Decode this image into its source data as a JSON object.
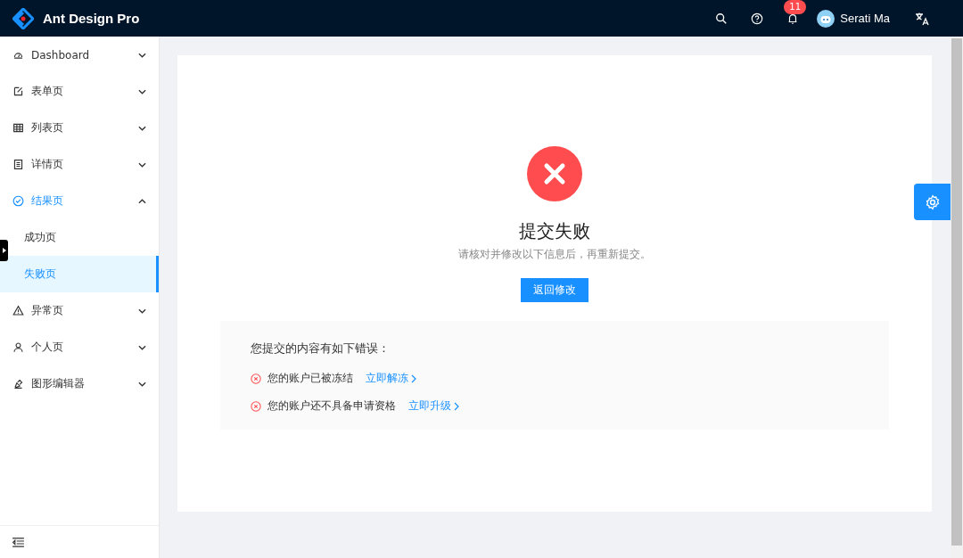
{
  "header": {
    "title": "Ant Design Pro",
    "notifications": "11",
    "user": "Serati Ma"
  },
  "menu": [
    {
      "kind": "dashboard",
      "label": "Dashboard",
      "expanded": false
    },
    {
      "kind": "form",
      "label": "表单页",
      "expanded": false
    },
    {
      "kind": "table",
      "label": "列表页",
      "expanded": false
    },
    {
      "kind": "profile",
      "label": "详情页",
      "expanded": false
    },
    {
      "kind": "result",
      "label": "结果页",
      "expanded": true,
      "children": [
        {
          "label": "成功页",
          "selected": false
        },
        {
          "label": "失败页",
          "selected": true
        }
      ]
    },
    {
      "kind": "exception",
      "label": "异常页",
      "expanded": false
    },
    {
      "kind": "account",
      "label": "个人页",
      "expanded": false
    },
    {
      "kind": "editor",
      "label": "图形编辑器",
      "expanded": false
    }
  ],
  "result": {
    "kind": "error",
    "title": "提交失败",
    "subtitle": "请核对并修改以下信息后，再重新提交。",
    "button": "返回修改",
    "errors_title": "您提交的内容有如下错误：",
    "errors": [
      {
        "text": "您的账户已被冻结",
        "link": "立即解冻"
      },
      {
        "text": "您的账户还不具备申请资格",
        "link": "立即升级"
      }
    ]
  }
}
